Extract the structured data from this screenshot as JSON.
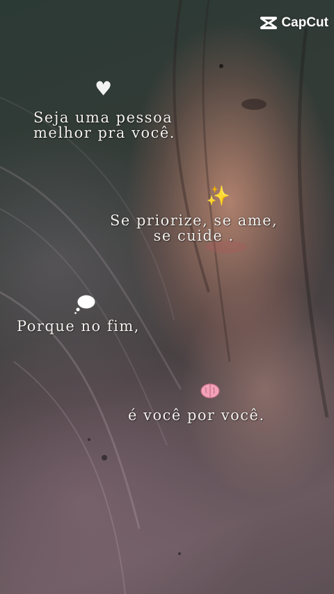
{
  "logo": {
    "text": "CapCut",
    "icon": "capcut-logo-icon"
  },
  "captions": {
    "first": {
      "line1": "Seja uma pessoa",
      "line2": "melhor pra você.",
      "emoji_icon": "white-heart-icon"
    },
    "second": {
      "line1": "Se priorize, se ame,",
      "line2": "se cuide .",
      "emoji_icon": "sparkles-icon"
    },
    "third": {
      "line1": "Porque no fim,",
      "emoji_icon": "thought-balloon-icon"
    },
    "fourth": {
      "line1": "é você por você.",
      "emoji_icon": "brain-icon"
    }
  },
  "colors": {
    "caption_text": "#f4f1ee",
    "logo_text": "#ffffff"
  }
}
